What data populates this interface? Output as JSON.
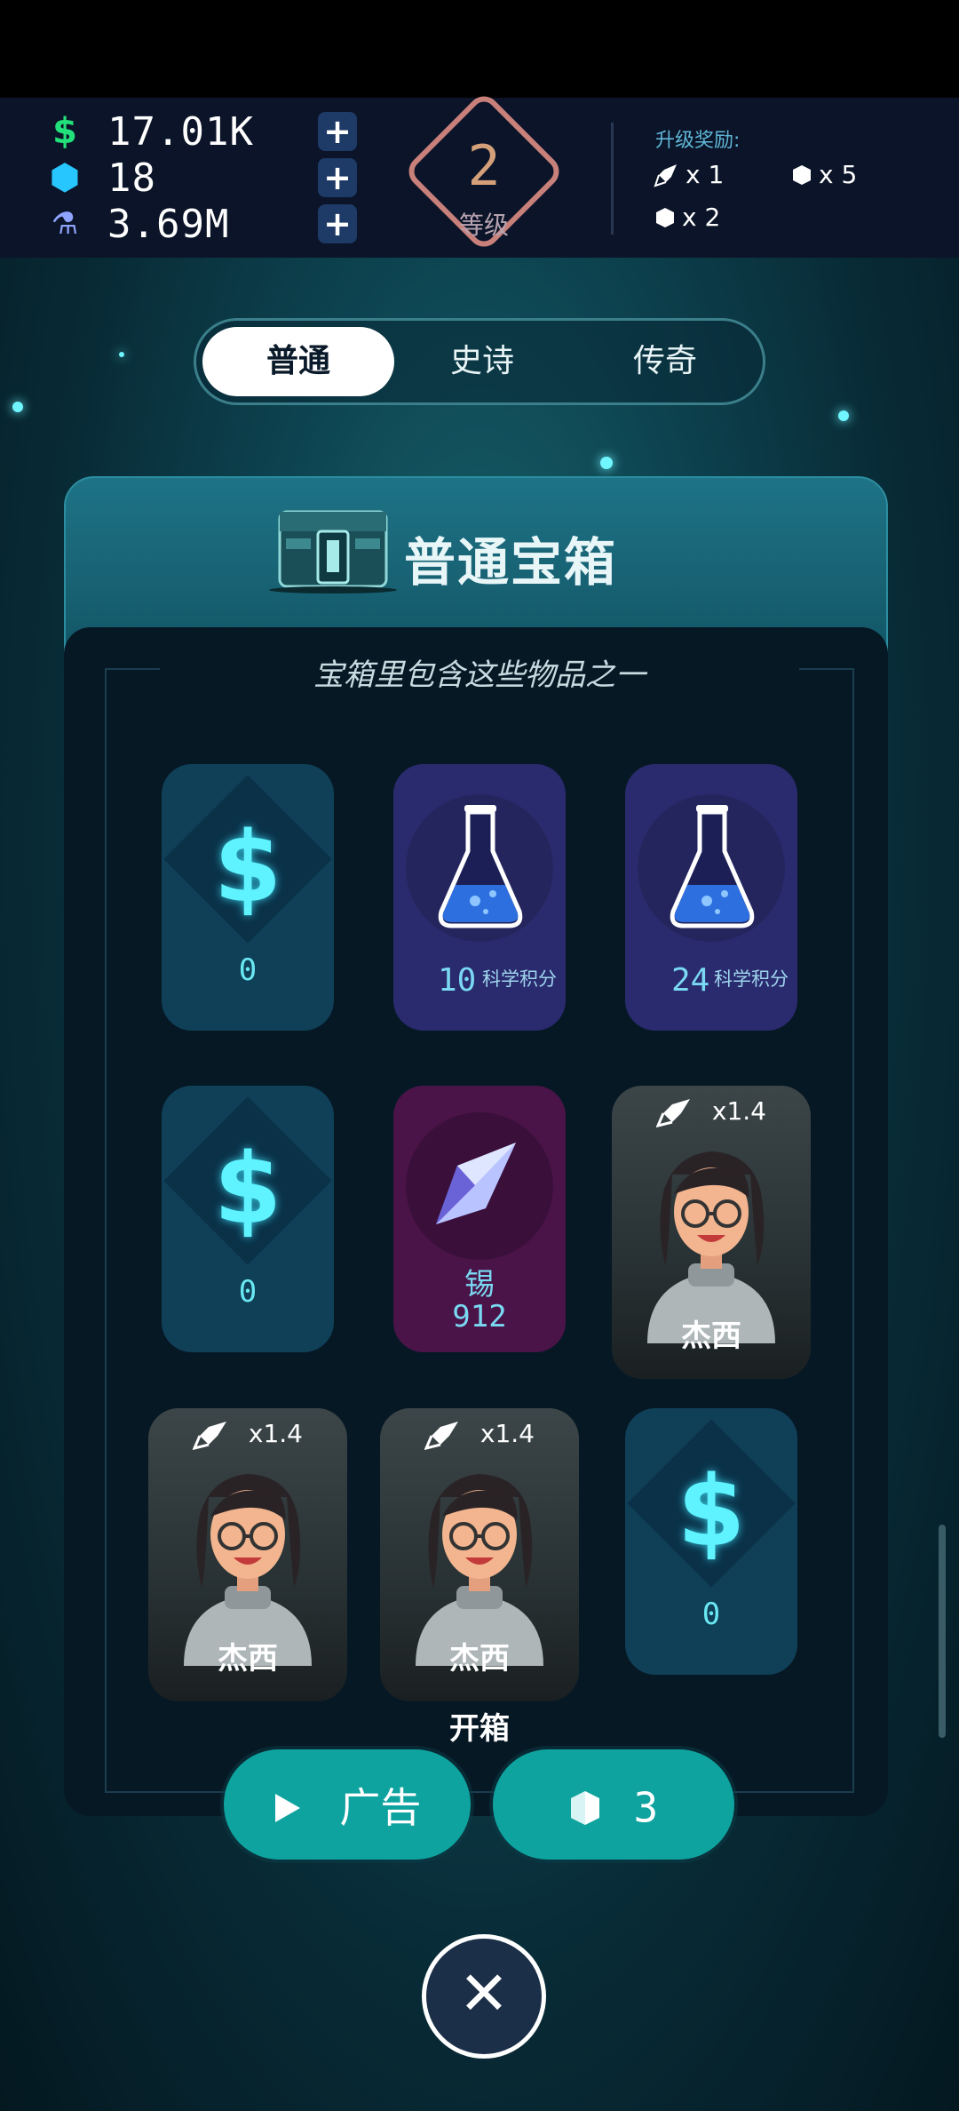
{
  "resources": [
    {
      "icon": "dollar-icon",
      "symbol": "$",
      "value": "17.01K",
      "color": "#22e07a"
    },
    {
      "icon": "gem-icon",
      "symbol": "⬢",
      "value": "18",
      "color": "#28c6ff"
    },
    {
      "icon": "flask-icon",
      "symbol": "⚗",
      "value": "3.69M",
      "color": "#8fa4ff"
    }
  ],
  "plus_symbol": "+",
  "level": {
    "number": "2",
    "label": "等级"
  },
  "rewards": {
    "title": "升级奖励:",
    "items": [
      {
        "icon": "rocket-icon",
        "text": "x 1"
      },
      {
        "icon": "gem-icon",
        "text": "x 5"
      },
      {
        "icon": "gem-icon",
        "text": "x 2"
      }
    ]
  },
  "tabs": [
    {
      "label": "普通",
      "active": true
    },
    {
      "label": "史诗",
      "active": false
    },
    {
      "label": "传奇",
      "active": false
    }
  ],
  "chest": {
    "title": "普通宝箱",
    "subtitle": "宝箱里包含这些物品之一",
    "items": [
      {
        "type": "money",
        "symbol": "$",
        "value": "0"
      },
      {
        "type": "science",
        "value": "10",
        "unit": "科学积分"
      },
      {
        "type": "science",
        "value": "24",
        "unit": "科学积分"
      },
      {
        "type": "money",
        "symbol": "$",
        "value": "0"
      },
      {
        "type": "tin",
        "name": "锡",
        "value": "912"
      },
      {
        "type": "person",
        "boost": "x1.4",
        "name": "杰西"
      },
      {
        "type": "person",
        "boost": "x1.4",
        "name": "杰西"
      },
      {
        "type": "person",
        "boost": "x1.4",
        "name": "杰西"
      },
      {
        "type": "money",
        "symbol": "$",
        "value": "0"
      }
    ]
  },
  "open_label": "开箱",
  "buttons": {
    "ad_label": "广告",
    "gem_cost": "3"
  },
  "close_symbol": "✕"
}
